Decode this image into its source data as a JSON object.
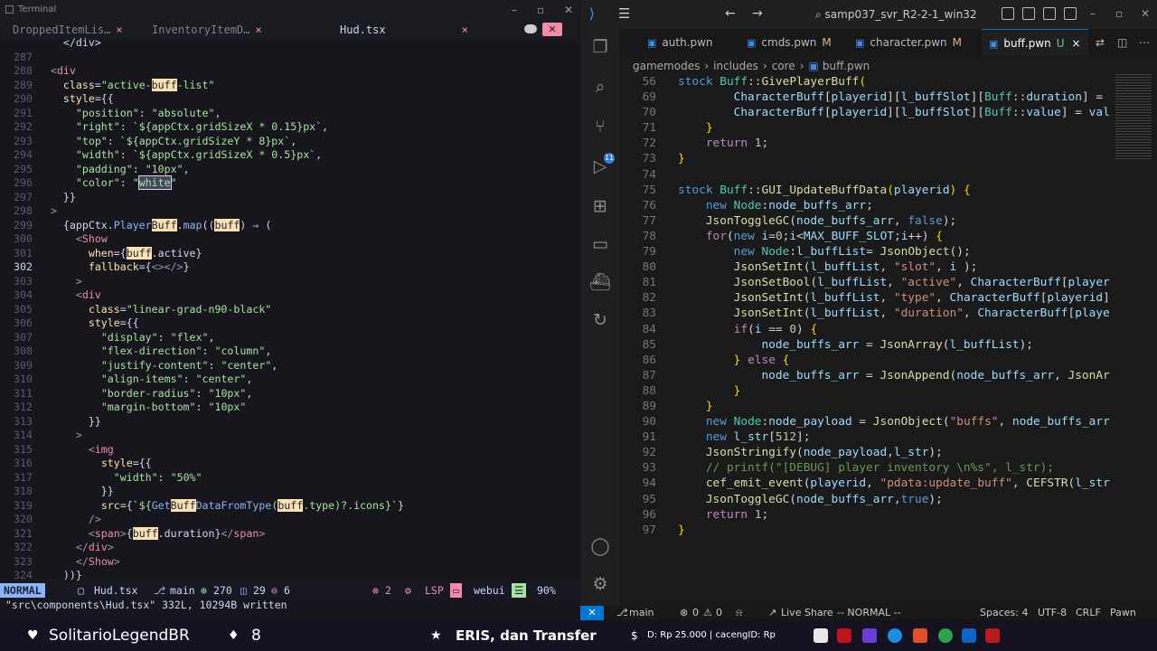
{
  "terminal": {
    "window_title": "Terminal",
    "tabs": [
      {
        "label": "DroppedItemLis…",
        "close": "×"
      },
      {
        "label": "InventoryItemD…",
        "close": "×"
      },
      {
        "label": "Hud.tsx",
        "close": "×"
      }
    ],
    "close_glyph": "✕",
    "status": {
      "mode": "NORMAL",
      "file": "Hud.tsx",
      "branch": "main",
      "added": "270",
      "modified": "29",
      "removed": "6",
      "errors": "2",
      "lsp": "LSP",
      "project": "webui",
      "progress": "90%"
    },
    "message": "\"src\\components\\Hud.tsx\" 332L, 10294B written"
  },
  "vscode": {
    "search_label": "samp037_svr_R2-2-1_win32",
    "tabs": [
      {
        "label": "auth.pwn",
        "marker": ""
      },
      {
        "label": "cmds.pwn",
        "marker": "M"
      },
      {
        "label": "character.pwn",
        "marker": "M"
      },
      {
        "label": "buff.pwn",
        "marker": "U"
      }
    ],
    "tab_close": "×",
    "breadcrumb": [
      "gamemodes",
      "includes",
      "core",
      "buff.pwn"
    ],
    "scm_badge": "11",
    "status": {
      "branch": "main",
      "errors": "0",
      "warnings": "0",
      "live_share": "Live Share",
      "vim_mode": "-- NORMAL --",
      "spaces": "Spaces: 4",
      "encoding": "UTF-8",
      "eol": "CRLF",
      "language": "Pawn"
    }
  },
  "taskbar": {
    "user": "SolitarioLegendBR",
    "count": "8",
    "ticker": "ERIS, dan Transfer",
    "info": "D: Rp 25.000 | cacengID: Rp"
  },
  "editor": {
    "terminal_lines": [
      {
        "n": "",
        "html": "    &lt;/div&gt;"
      },
      {
        "n": "287",
        "html": ""
      },
      {
        "n": "288",
        "html": "  <span class='p'>&lt;</span><span class='t'>div</span>"
      },
      {
        "n": "289",
        "html": "    <span class='y'>class</span>=<span class='s'>\"active-<span class='hl'>buff</span>-list\"</span>"
      },
      {
        "n": "290",
        "html": "    <span class='y'>style</span>={{"
      },
      {
        "n": "291",
        "html": "      <span class='s'>\"position\"</span>: <span class='s'>\"absolute\"</span>,"
      },
      {
        "n": "292",
        "html": "      <span class='s'>\"right\"</span>: <span class='s'>`${appCtx.gridSizeX * 0.15}px`</span>,"
      },
      {
        "n": "293",
        "html": "      <span class='s'>\"top\"</span>: <span class='s'>`${appCtx.gridSizeY * 8}px`</span>,"
      },
      {
        "n": "294",
        "html": "      <span class='s'>\"width\"</span>: <span class='s'>`${appCtx.gridSizeX * 0.5}px`</span>,"
      },
      {
        "n": "295",
        "html": "      <span class='s'>\"padding\"</span>: <span class='s'>\"10px\"</span>,"
      },
      {
        "n": "296",
        "html": "      <span class='s'>\"color\"</span>: <span class='s'>\"<span class='vis'>white</span>\"</span>"
      },
      {
        "n": "297",
        "html": "    }}"
      },
      {
        "n": "298",
        "html": "  <span class='p'>&gt;</span>"
      },
      {
        "n": "299",
        "html": "    {appCtx.<span class='f'>Player<span class='hl'>Buff</span></span>.<span class='f'>map</span>((<span class='hl'>buff</span>) <span class='k'>⇒</span> ("
      },
      {
        "n": "300",
        "html": "      <span class='p'>&lt;</span><span class='t'>Show</span>"
      },
      {
        "n": "301",
        "html": "        <span class='y'>when</span>={<span class='hl'>buff</span>.active}"
      },
      {
        "n": "302",
        "html": "        <span class='y'>fallback</span>={<span class='p'>&lt;&gt;&lt;/&gt;</span>}",
        "current": true
      },
      {
        "n": "303",
        "html": "      <span class='p'>&gt;</span>"
      },
      {
        "n": "304",
        "html": "      <span class='p'>&lt;</span><span class='t'>div</span>"
      },
      {
        "n": "305",
        "html": "        <span class='y'>class</span>=<span class='s'>\"linear-grad-n90-black\"</span>"
      },
      {
        "n": "306",
        "html": "        <span class='y'>style</span>={{"
      },
      {
        "n": "307",
        "html": "          <span class='s'>\"display\"</span>: <span class='s'>\"flex\"</span>,"
      },
      {
        "n": "308",
        "html": "          <span class='s'>\"flex-direction\"</span>: <span class='s'>\"column\"</span>,"
      },
      {
        "n": "309",
        "html": "          <span class='s'>\"justify-content\"</span>: <span class='s'>\"center\"</span>,"
      },
      {
        "n": "310",
        "html": "          <span class='s'>\"align-items\"</span>: <span class='s'>\"center\"</span>,"
      },
      {
        "n": "311",
        "html": "          <span class='s'>\"border-radius\"</span>: <span class='s'>\"10px\"</span>,"
      },
      {
        "n": "312",
        "html": "          <span class='s'>\"margin-bottom\"</span>: <span class='s'>\"10px\"</span>"
      },
      {
        "n": "313",
        "html": "        }}"
      },
      {
        "n": "314",
        "html": "      <span class='p'>&gt;</span>"
      },
      {
        "n": "315",
        "html": "        <span class='p'>&lt;</span><span class='t'>img</span>"
      },
      {
        "n": "316",
        "html": "          <span class='y'>style</span>={{"
      },
      {
        "n": "317",
        "html": "            <span class='s'>\"width\"</span>: <span class='s'>\"50%\"</span>"
      },
      {
        "n": "318",
        "html": "          }}"
      },
      {
        "n": "319",
        "html": "          <span class='y'>src</span>={<span class='s'>`${<span class='f'>Get<span class='hl'>Buff</span>DataFromType</span>(<span class='hl'>buff</span>.type)?.icons}`</span>}"
      },
      {
        "n": "320",
        "html": "        <span class='p'>/&gt;</span>"
      },
      {
        "n": "321",
        "html": "        <span class='p'>&lt;</span><span class='t'>span</span><span class='p'>&gt;</span>{<span class='hl'>buff</span>.duration}<span class='p'>&lt;/</span><span class='t'>span</span><span class='p'>&gt;</span>"
      },
      {
        "n": "322",
        "html": "      <span class='p'>&lt;/</span><span class='t'>div</span><span class='p'>&gt;</span>"
      },
      {
        "n": "323",
        "html": "      <span class='p'>&lt;/</span><span class='t'>Show</span><span class='p'>&gt;</span>"
      },
      {
        "n": "324",
        "html": "    ))}"
      }
    ],
    "vscode_lines": [
      {
        "n": "56",
        "html": "<span class='vk2'>stock</span> <span class='vty'>Buff</span>::<span class='vfn'>GivePlayerBuff</span><span class='vp'>(</span>"
      },
      {
        "n": "69",
        "html": "        <span class='vvar'>CharacterBuff</span>[<span class='vvar'>playerid</span>][<span class='vvar'>l_buffSlot</span>][<span class='vty'>Buff</span>::<span class='vvar'>duration</span>] = "
      },
      {
        "n": "70",
        "html": "        <span class='vvar'>CharacterBuff</span>[<span class='vvar'>playerid</span>][<span class='vvar'>l_buffSlot</span>][<span class='vty'>Buff</span>::<span class='vvar'>value</span>] = <span class='vvar'>val</span>"
      },
      {
        "n": "71",
        "html": "    <span class='vp'>}</span>"
      },
      {
        "n": "72",
        "html": "    <span class='vk'>return</span> <span class='vnum'>1</span>;"
      },
      {
        "n": "73",
        "html": "<span class='vp'>}</span>"
      },
      {
        "n": "74",
        "html": ""
      },
      {
        "n": "75",
        "html": "<span class='vk2'>stock</span> <span class='vty'>Buff</span>::<span class='vfn'>GUI_UpdateBuffData</span><span class='vp'>(</span><span class='vvar'>playerid</span><span class='vp'>)</span> <span class='vp'>{</span>"
      },
      {
        "n": "76",
        "html": "    <span class='vk2'>new</span> <span class='vty'>Node</span>:<span class='vvar'>node_buffs_arr</span>;"
      },
      {
        "n": "77",
        "html": "    <span class='vfn'>JsonToggleGC</span>(<span class='vvar'>node_buffs_arr</span>, <span class='vk2'>false</span>);"
      },
      {
        "n": "78",
        "html": "    <span class='vk'>for</span>(<span class='vk2'>new</span> <span class='vvar'>i</span>=<span class='vnum'>0</span>;<span class='vvar'>i</span>&lt;<span class='vvar'>MAX_BUFF_SLOT</span>;<span class='vvar'>i</span>++) <span class='vp'>{</span>"
      },
      {
        "n": "79",
        "html": "        <span class='vk2'>new</span> <span class='vty'>Node</span>:<span class='vvar'>l_buffList</span>= <span class='vfn'>JsonObject</span>();"
      },
      {
        "n": "80",
        "html": "        <span class='vfn'>JsonSetInt</span>(<span class='vvar'>l_buffList</span>, <span class='vstr'>\"slot\"</span>, <span class='vvar'>i</span> );"
      },
      {
        "n": "81",
        "html": "        <span class='vfn'>JsonSetBool</span>(<span class='vvar'>l_buffList</span>, <span class='vstr'>\"active\"</span>, <span class='vvar'>CharacterBuff</span>[<span class='vvar'>player</span>"
      },
      {
        "n": "82",
        "html": "        <span class='vfn'>JsonSetInt</span>(<span class='vvar'>l_buffList</span>, <span class='vstr'>\"type\"</span>, <span class='vvar'>CharacterBuff</span>[<span class='vvar'>playerid</span>]"
      },
      {
        "n": "83",
        "html": "        <span class='vfn'>JsonSetInt</span>(<span class='vvar'>l_buffList</span>, <span class='vstr'>\"duration\"</span>, <span class='vvar'>CharacterBuff</span>[<span class='vvar'>playe</span>"
      },
      {
        "n": "84",
        "html": "        <span class='vk'>if</span>(<span class='vvar'>i</span> == <span class='vnum'>0</span>) <span class='vp'>{</span>"
      },
      {
        "n": "85",
        "html": "            <span class='vvar'>node_buffs_arr</span> = <span class='vfn'>JsonArray</span>(<span class='vvar'>l_buffList</span>);"
      },
      {
        "n": "86",
        "html": "        <span class='vp'>}</span> <span class='vk'>else</span> <span class='vp'>{</span>"
      },
      {
        "n": "87",
        "html": "            <span class='vvar'>node_buffs_arr</span> = <span class='vfn'>JsonAppend</span>(<span class='vvar'>node_buffs_arr</span>, <span class='vfn'>JsonAr</span>"
      },
      {
        "n": "88",
        "html": "        <span class='vp'>}</span>"
      },
      {
        "n": "89",
        "html": "    <span class='vp'>}</span>"
      },
      {
        "n": "90",
        "html": "    <span class='vk2'>new</span> <span class='vty'>Node</span>:<span class='vvar'>node_payload</span> = <span class='vfn'>JsonObject</span>(<span class='vstr'>\"buffs\"</span>, <span class='vvar'>node_buffs_arr</span>"
      },
      {
        "n": "91",
        "html": "    <span class='vk2'>new</span> <span class='vvar'>l_str</span>[<span class='vnum'>512</span>];"
      },
      {
        "n": "92",
        "html": "    <span class='vfn'>JsonStringify</span>(<span class='vvar'>node_payload</span>,<span class='vvar'>l_str</span>);"
      },
      {
        "n": "93",
        "html": "    <span class='vcmt'>// printf(\"[DEBUG] player inventory \\n%s\", l_str);</span>"
      },
      {
        "n": "94",
        "html": "    <span class='vfn'>cef_emit_event</span>(<span class='vvar'>playerid</span>, <span class='vstr'>\"pdata:update_buff\"</span>, <span class='vfn'>CEFSTR</span>(<span class='vvar'>l_str</span>"
      },
      {
        "n": "95",
        "html": "    <span class='vfn'>JsonToggleGC</span>(<span class='vvar'>node_buffs_arr</span>,<span class='vk2'>true</span>);"
      },
      {
        "n": "96",
        "html": "    <span class='vk'>return</span> <span class='vnum'>1</span>;"
      },
      {
        "n": "97",
        "html": "<span class='vp'>}</span>"
      }
    ],
    "vscode_line57": "    <span class='vp'>}</span> <span class='vk'>else</span> <span class='vp'>{</span>"
  }
}
